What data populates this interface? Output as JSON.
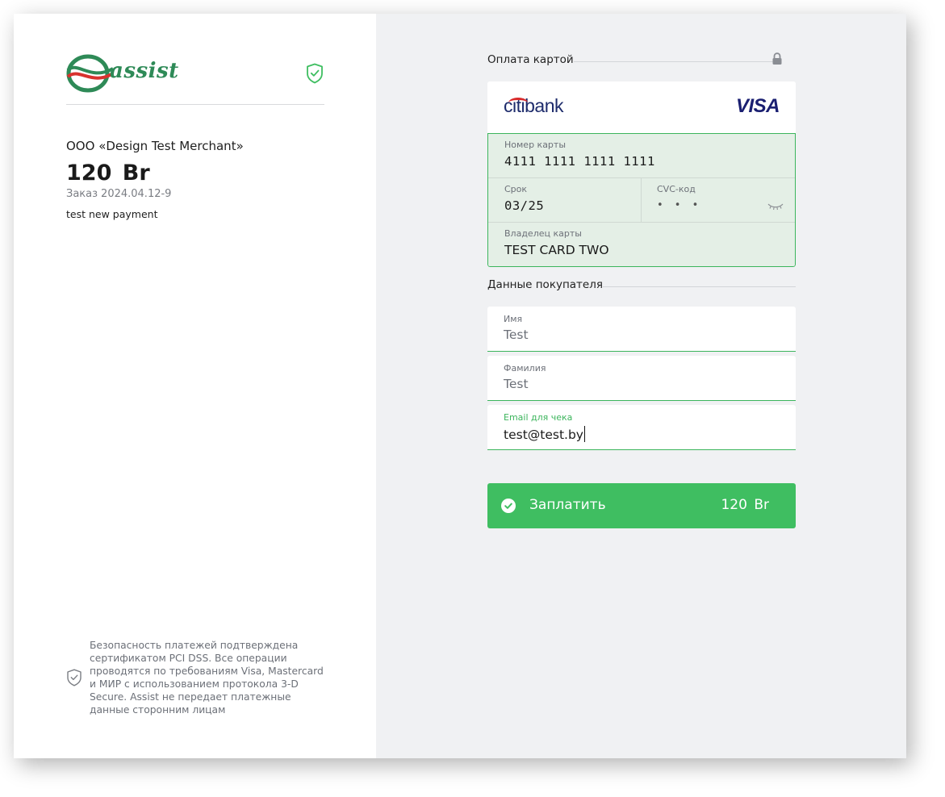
{
  "brand": {
    "logo_text": "assist",
    "accent": "#3fbe61",
    "logo_color": "#2e8a57"
  },
  "order_info": {
    "merchant": "ООО «Design Test Merchant»",
    "amount": "120 Br",
    "order_label": "Заказ",
    "order_number": "2024.04.12-9",
    "description": "test new payment"
  },
  "security_note": "Безопасность платежей подтверждена сертификатом PCI DSS. Все операции проводятся по требованиям Visa, Mastercard и МИР с использованием протокола 3-D Secure. Assist не передает платежные данные сторонним лицам",
  "card_section": {
    "title": "Оплата картой",
    "bank_name": "citibank",
    "card_brand": "VISA",
    "number_label": "Номер карты",
    "number_value": "4111 1111 1111 1111",
    "expiry_label": "Срок",
    "expiry_value": "03/25",
    "cvc_label": "CVC-код",
    "cvc_value": "• • •",
    "holder_label": "Владелец карты",
    "holder_value": "TEST CARD TWO"
  },
  "buyer_section": {
    "title": "Данные покупателя",
    "first_name_label": "Имя",
    "first_name_value": "Test",
    "last_name_label": "Фамилия",
    "last_name_value": "Test",
    "email_label": "Email для чека",
    "email_value": "test@test.by"
  },
  "pay_button": {
    "label": "Заплатить",
    "amount": "120 Br"
  },
  "icons": [
    "shield-check-icon",
    "lock-icon",
    "eye-closed-icon",
    "check-circle-icon"
  ]
}
